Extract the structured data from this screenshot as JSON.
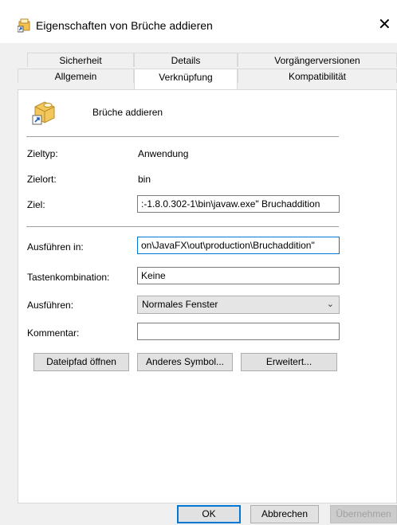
{
  "window": {
    "title": "Eigenschaften von Brüche addieren",
    "close_glyph": "✕"
  },
  "tabs_row1": [
    {
      "label": "Sicherheit"
    },
    {
      "label": "Details"
    },
    {
      "label": "Vorgängerversionen"
    }
  ],
  "tabs_row2": [
    {
      "label": "Allgemein"
    },
    {
      "label": "Verknüpfung",
      "active": true
    },
    {
      "label": "Kompatibilität"
    }
  ],
  "shortcut": {
    "name": "Brüche addieren",
    "icon": "shortcut-application-icon",
    "zieltyp_label": "Zieltyp:",
    "zieltyp_value": "Anwendung",
    "zielort_label": "Zielort:",
    "zielort_value": "bin",
    "ziel_label": "Ziel:",
    "ziel_value": ":-1.8.0.302-1\\bin\\javaw.exe\" Bruchaddition",
    "ausfuehren_in_label": "Ausführen in:",
    "ausfuehren_in_value": "on\\JavaFX\\out\\production\\Bruchaddition\"",
    "tastenkombination_label": "Tastenkombination:",
    "tastenkombination_value": "Keine",
    "ausfuehren_label": "Ausführen:",
    "ausfuehren_value": "Normales Fenster",
    "kommentar_label": "Kommentar:",
    "kommentar_value": ""
  },
  "buttons": {
    "open_path": "Dateipfad öffnen",
    "change_icon": "Anderes Symbol...",
    "advanced": "Erweitert...",
    "ok": "OK",
    "cancel": "Abbrechen",
    "apply": "Übernehmen"
  }
}
